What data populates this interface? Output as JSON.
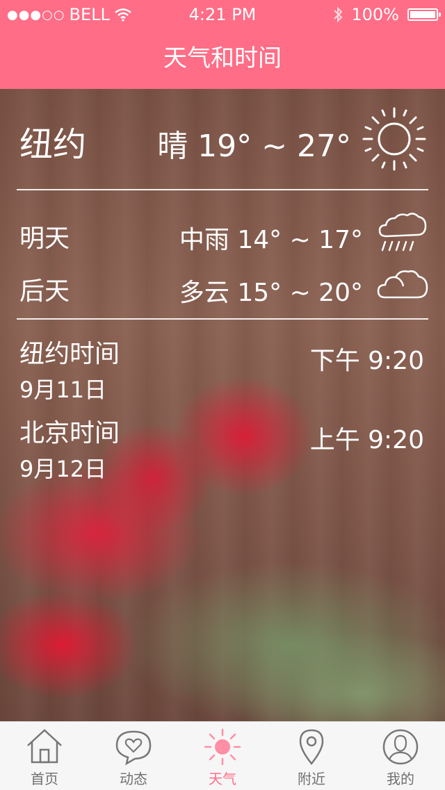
{
  "status_bar": {
    "signal_dots": "●●●○○",
    "carrier": "BELL",
    "time": "4:21 PM",
    "bluetooth_icon": "bluetooth-icon",
    "battery_text": "100%"
  },
  "nav": {
    "title": "天气和时间"
  },
  "today": {
    "city": "纽约",
    "condition": "晴 19° ~ 27°",
    "icon": "sun-icon"
  },
  "forecast": [
    {
      "day": "明天",
      "condition": "中雨 14° ~ 17°",
      "icon": "rain-cloud-icon"
    },
    {
      "day": "后天",
      "condition": "多云 15° ~ 20°",
      "icon": "cloud-icon"
    }
  ],
  "timezones": [
    {
      "label": "纽约时间",
      "date": "9月11日",
      "time": "下午  9:20"
    },
    {
      "label": "北京时间",
      "date": "9月12日",
      "time": "上午  9:20"
    }
  ],
  "tabs": [
    {
      "label": "首页",
      "icon": "home-icon",
      "active": false
    },
    {
      "label": "动态",
      "icon": "heart-bubble-icon",
      "active": false
    },
    {
      "label": "天气",
      "icon": "sun-icon",
      "active": true
    },
    {
      "label": "附近",
      "icon": "location-pin-icon",
      "active": false
    },
    {
      "label": "我的",
      "icon": "user-icon",
      "active": false
    }
  ],
  "colors": {
    "accent": "#ff6d86",
    "tab_inactive": "#6f6f6f",
    "tab_bar_bg": "#f6f6f6"
  }
}
